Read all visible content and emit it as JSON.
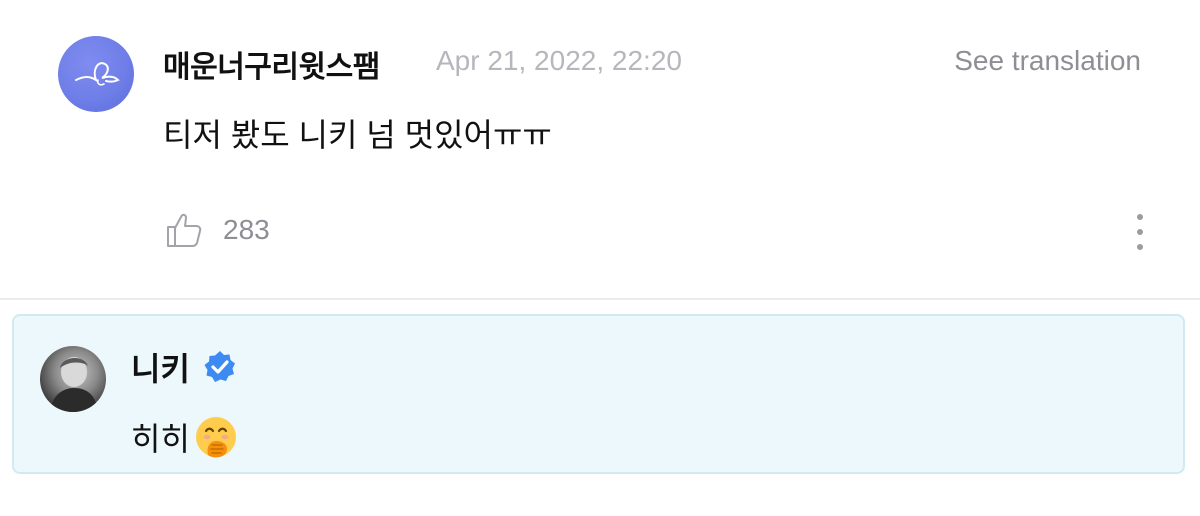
{
  "comment": {
    "username": "매운너구리윗스팸",
    "timestamp": "Apr 21, 2022, 22:20",
    "translate_label": "See translation",
    "text": "티저 봤도 니키 넘 멋있어ㅠㅠ",
    "like_count": "283",
    "icons": {
      "like": "thumbs-up-icon",
      "more": "more-vertical-icon"
    }
  },
  "reply": {
    "author": "니키",
    "verified": true,
    "text": "히히",
    "emoji": "hand-over-mouth-emoji"
  },
  "colors": {
    "reply_background": "#edf8fc",
    "reply_border": "#d2e9f2",
    "verified_blue": "#3d8bf2",
    "muted_text": "#8e8e95",
    "timestamp_text": "#b6b6bd"
  }
}
